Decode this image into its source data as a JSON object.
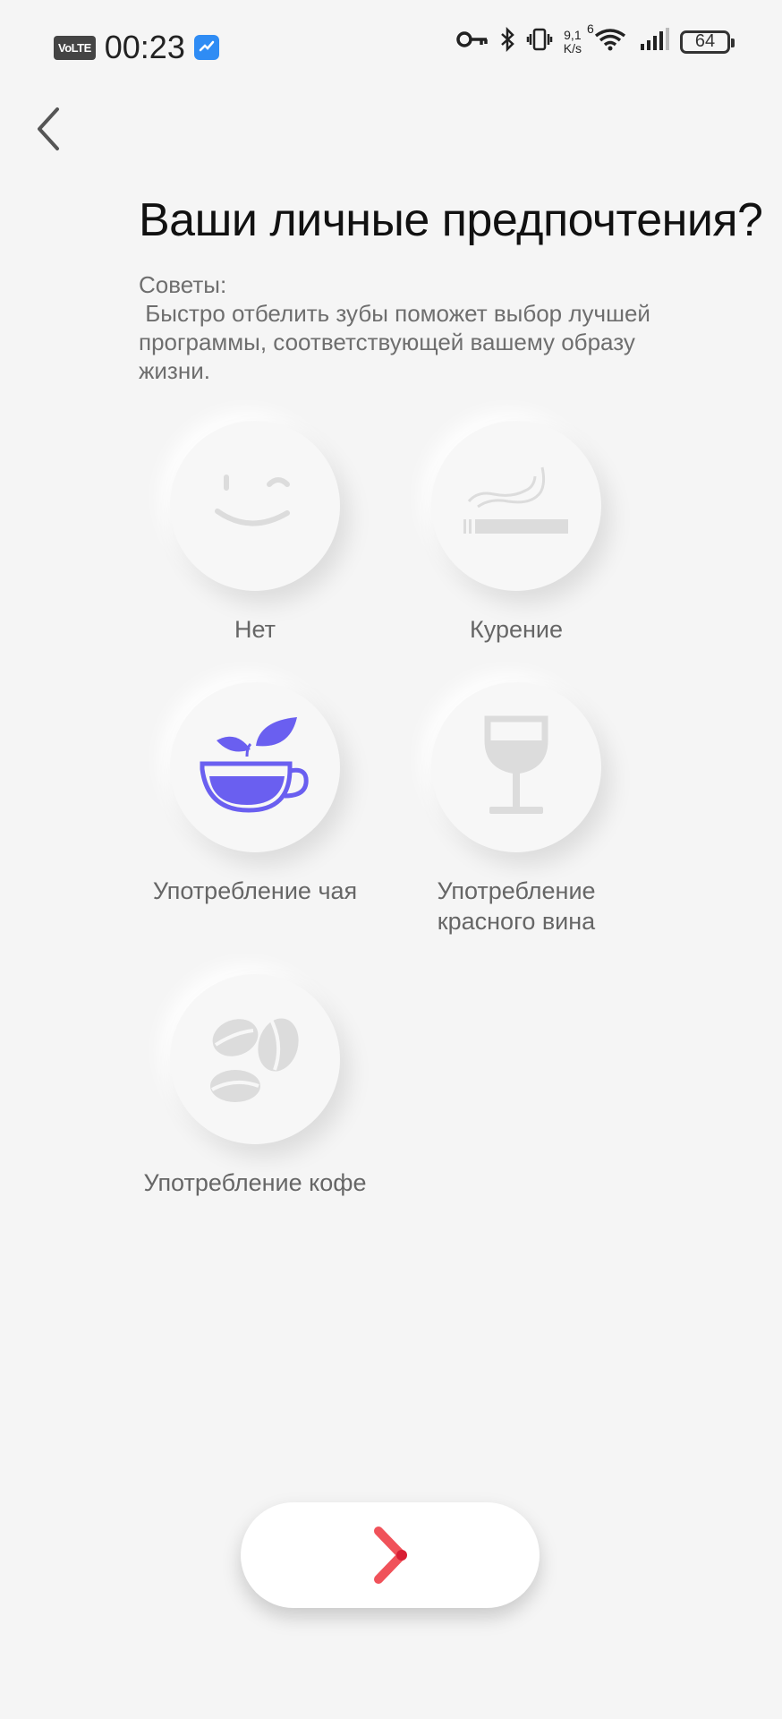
{
  "status_bar": {
    "volte": "VoLTE",
    "time": "00:23",
    "speed_value": "9,1",
    "speed_unit": "K/s",
    "network": "6",
    "battery": "64"
  },
  "header": {
    "title": "Ваши личные предпочтения?"
  },
  "tips": {
    "heading": "Советы:",
    "body": " Быстро отбелить зубы поможет выбор лучшей программы, соответствующей вашему образу жизни."
  },
  "options": [
    {
      "label": "Нет",
      "icon": "smiley-wink-icon",
      "selected": false
    },
    {
      "label": "Курение",
      "icon": "cigarette-icon",
      "selected": false
    },
    {
      "label": "Употребление чая",
      "icon": "tea-cup-icon",
      "selected": true
    },
    {
      "label": "Употребление красного вина",
      "icon": "wine-glass-icon",
      "selected": false
    },
    {
      "label": "Употребление кофе",
      "icon": "coffee-beans-icon",
      "selected": false
    }
  ],
  "colors": {
    "selected": "#6a5ff0",
    "unselected": "#dcdcdc",
    "next_arrow": "#f0525a"
  },
  "next_button": {
    "icon": "chevron-right-icon"
  }
}
